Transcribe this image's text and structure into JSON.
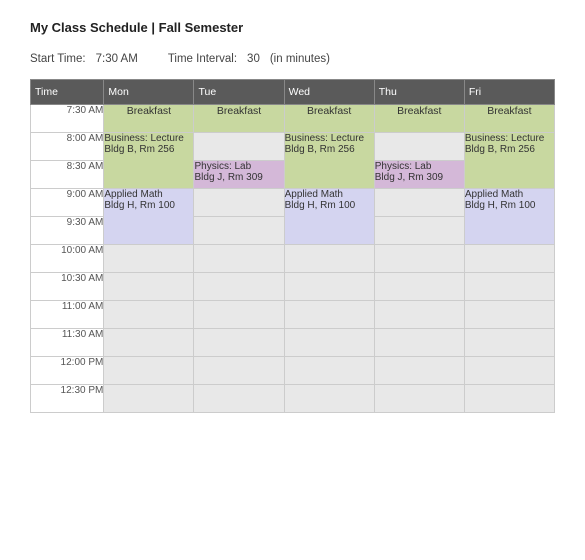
{
  "title": "My Class Schedule | Fall Semester",
  "meta": {
    "start_time_label": "Start Time:",
    "start_time_value": "7:30 AM",
    "interval_label": "Time Interval:",
    "interval_value": "30",
    "interval_unit": "(in minutes)"
  },
  "headers": {
    "time": "Time",
    "mon": "Mon",
    "tue": "Tue",
    "wed": "Wed",
    "thu": "Thu",
    "fri": "Fri"
  },
  "rows": [
    {
      "time": "7:30 AM"
    },
    {
      "time": "8:00 AM"
    },
    {
      "time": "8:30 AM"
    },
    {
      "time": "9:00 AM"
    },
    {
      "time": "9:30 AM"
    },
    {
      "time": "10:00 AM"
    },
    {
      "time": "10:30 AM"
    },
    {
      "time": "11:00 AM"
    },
    {
      "time": "11:30 AM"
    },
    {
      "time": "12:00 PM"
    },
    {
      "time": "12:30 PM"
    }
  ],
  "cells": {
    "breakfast": "Breakfast",
    "business": "Business: Lecture\nBldg B, Rm 256",
    "physics": "Physics: Lab\nBldg J, Rm 309",
    "math": "Applied Math\nBldg H, Rm 100"
  }
}
